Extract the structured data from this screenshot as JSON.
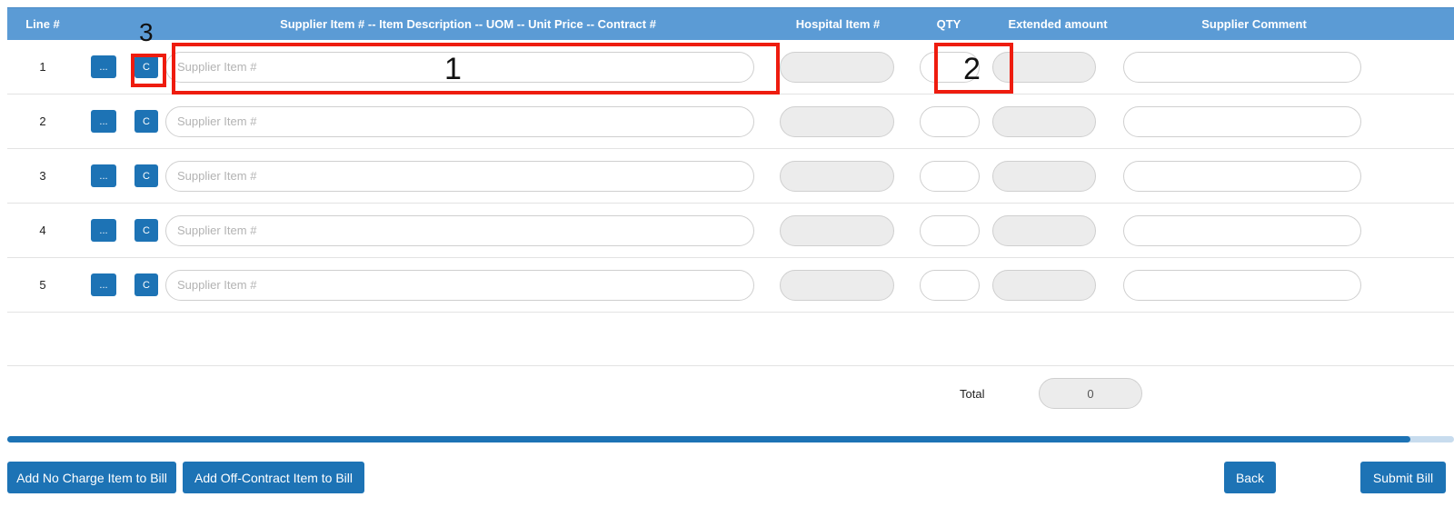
{
  "table": {
    "headers": {
      "line": "Line #",
      "supplier": "Supplier Item # -- Item Description -- UOM -- Unit Price -- Contract #",
      "hospital": "Hospital Item #",
      "qty": "QTY",
      "extended": "Extended amount",
      "comment": "Supplier Comment"
    },
    "dots_label": "...",
    "c_label": "C",
    "supplier_placeholder": "Supplier Item #",
    "rows": [
      {
        "line": "1"
      },
      {
        "line": "2"
      },
      {
        "line": "3"
      },
      {
        "line": "4"
      },
      {
        "line": "5"
      }
    ],
    "total_label": "Total",
    "total_value": "0"
  },
  "progress": {
    "fraction": 0.97
  },
  "buttons": {
    "add_no_charge": "Add No Charge Item to Bill",
    "add_off_contract": "Add Off-Contract Item to Bill",
    "back": "Back",
    "submit": "Submit Bill"
  },
  "annotations": {
    "supplier_field": "1",
    "qty_field": "2",
    "c_button": "3"
  },
  "colors": {
    "header_bg": "#5b9bd5",
    "button": "#1d73b5",
    "annotation": "#ee1c0f"
  }
}
